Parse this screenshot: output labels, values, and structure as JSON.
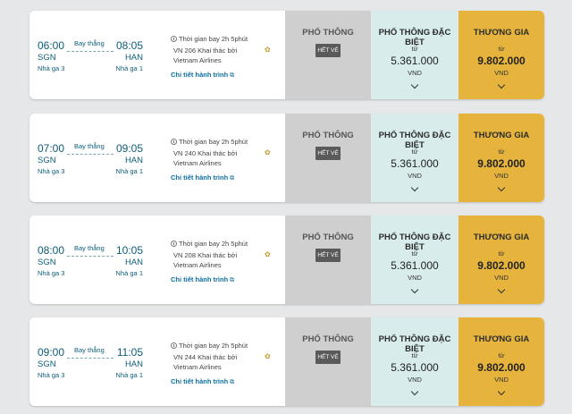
{
  "labels": {
    "direct": "Bay thẳng",
    "duration": "Thời gian bay 2h 5phút",
    "detail_link": "Chi tiết hành trình",
    "detail_link_icon": "⧉",
    "economy_title": "PHỔ THÔNG",
    "sold_out": "HẾT VÉ",
    "deluxe_title": "PHỔ THÔNG ĐẶC BIỆT",
    "business_title": "THƯƠNG GIA",
    "from": "từ",
    "currency": "VND"
  },
  "icons": {
    "duration": "clock-icon",
    "airline": "lotus-logo-icon",
    "detail_link": "external-link-icon",
    "expand": "chevron-down-icon"
  },
  "colors": {
    "economy_bg": "#cfcfcf",
    "deluxe_bg": "#d7eceb",
    "business_bg": "#e6b43d",
    "brand_text": "#0b5d7a"
  },
  "flights": [
    {
      "dep_time": "06:00",
      "dep_code": "SGN",
      "dep_terminal": "Nhà ga 3",
      "arr_time": "08:05",
      "arr_code": "HAN",
      "arr_terminal": "Nhà ga 1",
      "flight_info": "VN 206 Khai thác bởi Vietnam Airlines",
      "deluxe_price": "5.361.000",
      "business_price": "9.802.000"
    },
    {
      "dep_time": "07:00",
      "dep_code": "SGN",
      "dep_terminal": "Nhà ga 3",
      "arr_time": "09:05",
      "arr_code": "HAN",
      "arr_terminal": "Nhà ga 1",
      "flight_info": "VN 240 Khai thác bởi Vietnam Airlines",
      "deluxe_price": "5.361.000",
      "business_price": "9.802.000"
    },
    {
      "dep_time": "08:00",
      "dep_code": "SGN",
      "dep_terminal": "Nhà ga 3",
      "arr_time": "10:05",
      "arr_code": "HAN",
      "arr_terminal": "Nhà ga 1",
      "flight_info": "VN 208 Khai thác bởi Vietnam Airlines",
      "deluxe_price": "5.361.000",
      "business_price": "9.802.000"
    },
    {
      "dep_time": "09:00",
      "dep_code": "SGN",
      "dep_terminal": "Nhà ga 3",
      "arr_time": "11:05",
      "arr_code": "HAN",
      "arr_terminal": "Nhà ga 1",
      "flight_info": "VN 244 Khai thác bởi Vietnam Airlines",
      "deluxe_price": "5.361.000",
      "business_price": "9.802.000"
    }
  ]
}
